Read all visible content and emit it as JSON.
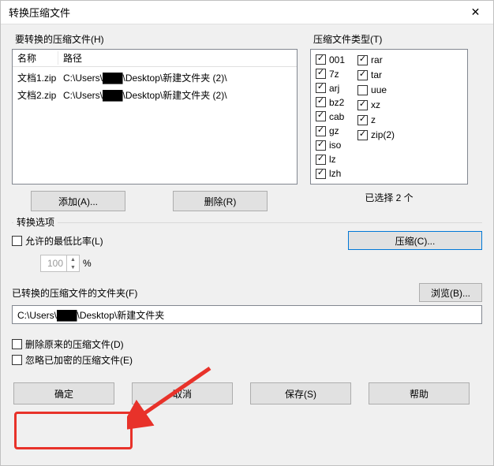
{
  "window": {
    "title": "转换压缩文件"
  },
  "files": {
    "group_label": "要转换的压缩文件(H)",
    "col_name": "名称",
    "col_path": "路径",
    "rows": [
      {
        "name": "文档1.zip",
        "path": "C:\\Users\\███\\Desktop\\新建文件夹 (2)\\"
      },
      {
        "name": "文档2.zip",
        "path": "C:\\Users\\███\\Desktop\\新建文件夹 (2)\\"
      }
    ]
  },
  "types": {
    "group_label": "压缩文件类型(T)",
    "col1": [
      {
        "label": "001",
        "checked": true
      },
      {
        "label": "7z",
        "checked": true
      },
      {
        "label": "arj",
        "checked": true
      },
      {
        "label": "bz2",
        "checked": true
      },
      {
        "label": "cab",
        "checked": true
      },
      {
        "label": "gz",
        "checked": true
      },
      {
        "label": "iso",
        "checked": true
      },
      {
        "label": "lz",
        "checked": true
      },
      {
        "label": "lzh",
        "checked": true
      }
    ],
    "col2": [
      {
        "label": "rar",
        "checked": true
      },
      {
        "label": "tar",
        "checked": true
      },
      {
        "label": "uue",
        "checked": false
      },
      {
        "label": "xz",
        "checked": true
      },
      {
        "label": "z",
        "checked": true
      },
      {
        "label": "zip(2)",
        "checked": true
      }
    ],
    "selected_count_text": "已选择 2 个"
  },
  "buttons": {
    "add": "添加(A)...",
    "remove": "删除(R)",
    "compress": "压缩(C)...",
    "browse": "浏览(B)...",
    "ok": "确定",
    "cancel": "取消",
    "save": "保存(S)",
    "help": "帮助"
  },
  "options": {
    "group_label": "转换选项",
    "allow_min_ratio": {
      "label": "允许的最低比率(L)",
      "checked": false
    },
    "min_ratio_value": "100",
    "percent": "%"
  },
  "folder": {
    "label": "已转换的压缩文件的文件夹(F)",
    "path": "C:\\Users\\███\\Desktop\\新建文件夹"
  },
  "bottom_checks": {
    "delete_original": {
      "label": "删除原来的压缩文件(D)",
      "checked": false
    },
    "ignore_encrypted": {
      "label": "忽略已加密的压缩文件(E)",
      "checked": false
    }
  }
}
